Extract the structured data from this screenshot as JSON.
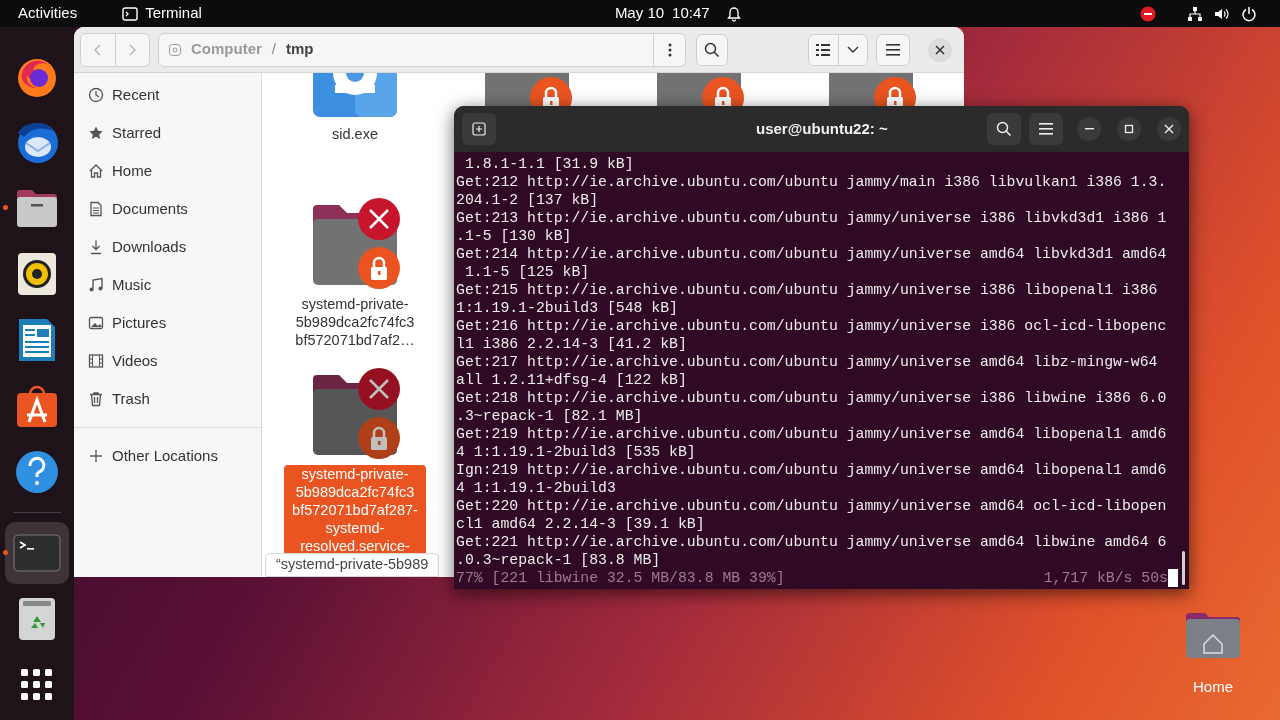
{
  "top_bar": {
    "activities": "Activities",
    "app_name": "Terminal",
    "date": "May 10",
    "time": "10:47"
  },
  "dock": [
    {
      "kind": "firefox",
      "running": false,
      "selected": false
    },
    {
      "kind": "thunderbird",
      "running": false,
      "selected": false
    },
    {
      "kind": "files",
      "running": true,
      "selected": false
    },
    {
      "kind": "rhythmbox",
      "running": false,
      "selected": false
    },
    {
      "kind": "writer",
      "running": false,
      "selected": false
    },
    {
      "kind": "appcenter",
      "running": false,
      "selected": false
    },
    {
      "kind": "help",
      "running": false,
      "selected": false
    },
    {
      "kind": "separator"
    },
    {
      "kind": "terminal",
      "running": true,
      "selected": true
    },
    {
      "kind": "trash",
      "running": false,
      "selected": false
    },
    {
      "kind": "apps",
      "running": false,
      "selected": false
    }
  ],
  "file_manager": {
    "path": [
      "Computer",
      "tmp"
    ],
    "path_separator": "/",
    "sidebar": [
      {
        "kind": "recent",
        "label": "Recent",
        "selected": false
      },
      {
        "kind": "starred",
        "label": "Starred",
        "selected": false
      },
      {
        "kind": "home",
        "label": "Home",
        "selected": false
      },
      {
        "kind": "documents",
        "label": "Documents",
        "selected": false
      },
      {
        "kind": "downloads",
        "label": "Downloads",
        "selected": false
      },
      {
        "kind": "music",
        "label": "Music",
        "selected": false
      },
      {
        "kind": "pictures",
        "label": "Pictures",
        "selected": false
      },
      {
        "kind": "videos",
        "label": "Videos",
        "selected": false
      },
      {
        "kind": "trash",
        "label": "Trash",
        "selected": false
      },
      {
        "kind": "other",
        "label": "Other Locations",
        "selected": false
      }
    ],
    "files": [
      {
        "kind": "exe",
        "name": "sid.exe",
        "selected": false
      },
      {
        "kind": "locked-folder",
        "selected": false
      },
      {
        "kind": "locked-folder",
        "selected": false
      },
      {
        "kind": "locked-folder",
        "selected": false
      },
      {
        "kind": "locked-folder",
        "name": "systemd-private-5b989dca2fc74fc3bf572071bd7af2…",
        "selected": false
      },
      {
        "kind": "spacer"
      },
      {
        "kind": "spacer"
      },
      {
        "kind": "spacer"
      },
      {
        "kind": "locked-folder",
        "name": "systemd-private-5b989dca2fc74fc3bf572071bd7af287-systemd-resolved.service-",
        "selected": true
      }
    ],
    "status_tooltip": "“systemd-private-5b989"
  },
  "terminal": {
    "title": "user@ubuntu22: ~",
    "lines": [
      " 1.8.1-1.1 [31.9 kB]",
      "Get:212 http://ie.archive.ubuntu.com/ubuntu jammy/main i386 libvulkan1 i386 1.3.",
      "204.1-2 [137 kB]",
      "Get:213 http://ie.archive.ubuntu.com/ubuntu jammy/universe i386 libvkd3d1 i386 1",
      ".1-5 [130 kB]",
      "Get:214 http://ie.archive.ubuntu.com/ubuntu jammy/universe amd64 libvkd3d1 amd64",
      " 1.1-5 [125 kB]",
      "Get:215 http://ie.archive.ubuntu.com/ubuntu jammy/universe i386 libopenal1 i386",
      "1:1.19.1-2build3 [548 kB]",
      "Get:216 http://ie.archive.ubuntu.com/ubuntu jammy/universe i386 ocl-icd-libopenc",
      "l1 i386 2.2.14-3 [41.2 kB]",
      "Get:217 http://ie.archive.ubuntu.com/ubuntu jammy/universe amd64 libz-mingw-w64",
      "all 1.2.11+dfsg-4 [122 kB]",
      "Get:218 http://ie.archive.ubuntu.com/ubuntu jammy/universe i386 libwine i386 6.0",
      ".3~repack-1 [82.1 MB]",
      "Get:219 http://ie.archive.ubuntu.com/ubuntu jammy/universe amd64 libopenal1 amd6",
      "4 1:1.19.1-2build3 [535 kB]",
      "Ign:219 http://ie.archive.ubuntu.com/ubuntu jammy/universe amd64 libopenal1 amd6",
      "4 1:1.19.1-2build3",
      "Get:220 http://ie.archive.ubuntu.com/ubuntu jammy/universe amd64 ocl-icd-libopen",
      "cl1 amd64 2.2.14-3 [39.1 kB]",
      "Get:221 http://ie.archive.ubuntu.com/ubuntu jammy/universe amd64 libwine amd64 6",
      ".0.3~repack-1 [83.8 MB]"
    ],
    "progress": "77% [221 libwine 32.5 MB/83.8 MB 39%]",
    "speed": "1,717 kB/s 50s"
  },
  "desktop_icons": [
    {
      "label": "Home"
    }
  ]
}
